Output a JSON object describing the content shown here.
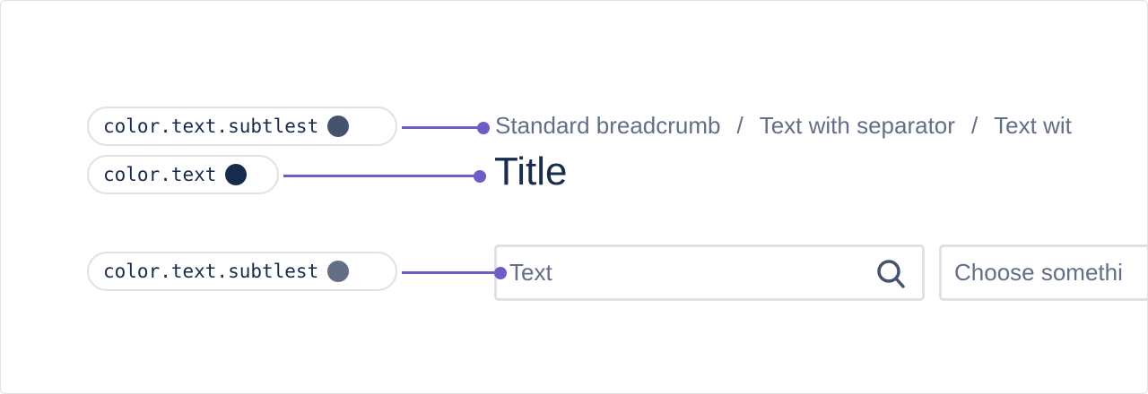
{
  "annotations": [
    {
      "token": "color.text.subtlest",
      "swatch": "#44546f"
    },
    {
      "token": "color.text",
      "swatch": "#172b4d"
    },
    {
      "token": "color.text.subtlest",
      "swatch": "#626f86"
    }
  ],
  "accent": "#6e5dc6",
  "breadcrumb": {
    "items": [
      "Standard breadcrumb",
      "Text with separator",
      "Text wit"
    ],
    "separator": "/"
  },
  "title": "Title",
  "search_input": {
    "placeholder": "Text"
  },
  "select": {
    "placeholder": "Choose somethi"
  }
}
